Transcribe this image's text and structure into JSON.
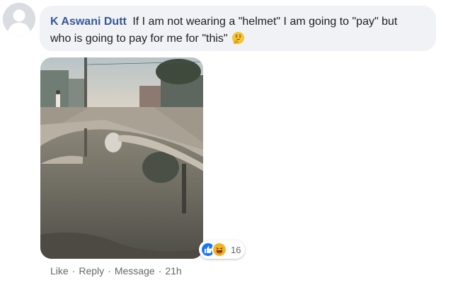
{
  "comment": {
    "author": "K Aswani Dutt",
    "text_line1": "If I am not wearing a \"helmet\" I am going to \"pay\" but",
    "text_line2": "who is going to pay for me for \"this\"",
    "inline_emoji": "thinking-face-icon"
  },
  "reactions": {
    "icons": [
      "like-reaction-icon",
      "haha-reaction-icon"
    ],
    "count": "16"
  },
  "actions": {
    "like": "Like",
    "reply": "Reply",
    "message": "Message",
    "separator": "·",
    "time": "21h"
  },
  "colors": {
    "author": "#385898",
    "bubble_bg": "#f0f2f5",
    "meta_text": "#65676b",
    "like_blue": "#1877f2",
    "haha_yellow": "#f7b125"
  }
}
